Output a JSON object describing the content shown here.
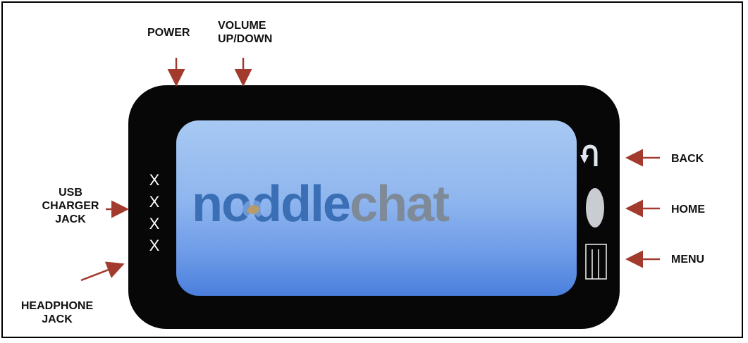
{
  "labels": {
    "power": "POWER",
    "volume": "VOLUME\nUP/DOWN",
    "usb": "USB\nCHARGER\nJACK",
    "headphone": "HEADPHONE\nJACK",
    "back": "BACK",
    "home": "HOME",
    "menu": "MENU"
  },
  "logo": {
    "part1": "noddle",
    "part2": "chat"
  },
  "ports": [
    "X",
    "X",
    "X",
    "X"
  ],
  "colors": {
    "device": "#070707",
    "arrow": "#a23b2e",
    "logo_blue": "#3a6fb5",
    "logo_gray": "#7f8a99"
  },
  "icons": [
    "back-arrow-icon",
    "home-button-icon",
    "menu-button-icon"
  ]
}
